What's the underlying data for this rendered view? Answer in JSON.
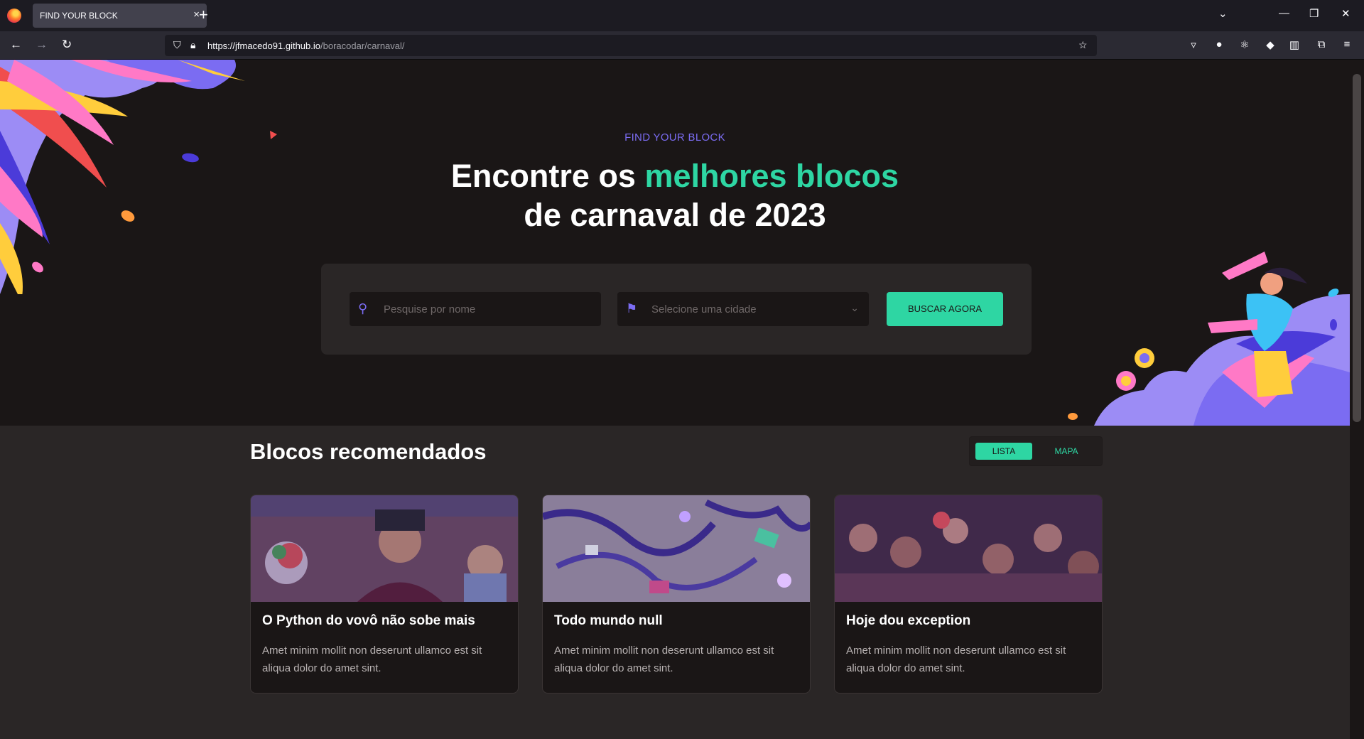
{
  "browser": {
    "tab_title": "FIND YOUR BLOCK",
    "tab_close": "×",
    "new_tab": "+",
    "url_host": "https://jfmacedo91.github.io",
    "url_path": "/boracodar/carnaval/"
  },
  "hero": {
    "eyebrow": "FIND YOUR BLOCK",
    "headline_part1": "Encontre os ",
    "headline_accent": "melhores blocos",
    "headline_line2": "de carnaval de 2023"
  },
  "search": {
    "name_placeholder": "Pesquise por nome",
    "city_placeholder": "Selecione uma cidade",
    "button": "BUSCAR AGORA"
  },
  "section": {
    "title": "Blocos recomendados",
    "toggle_list": "LISTA",
    "toggle_map": "MAPA"
  },
  "cards": [
    {
      "title": "O Python do vovô não sobe mais",
      "description": "Amet minim mollit non deserunt ullamco est sit aliqua dolor do amet sint."
    },
    {
      "title": "Todo mundo null",
      "description": "Amet minim mollit non deserunt ullamco est sit aliqua dolor do amet sint."
    },
    {
      "title": "Hoje dou exception",
      "description": "Amet minim mollit non deserunt ullamco est sit aliqua dolor do amet sint."
    }
  ],
  "colors": {
    "accent_green": "#2ed6a3",
    "accent_purple": "#7b6cf2",
    "page_bg": "#2a2626",
    "hero_bg": "#1a1616"
  }
}
